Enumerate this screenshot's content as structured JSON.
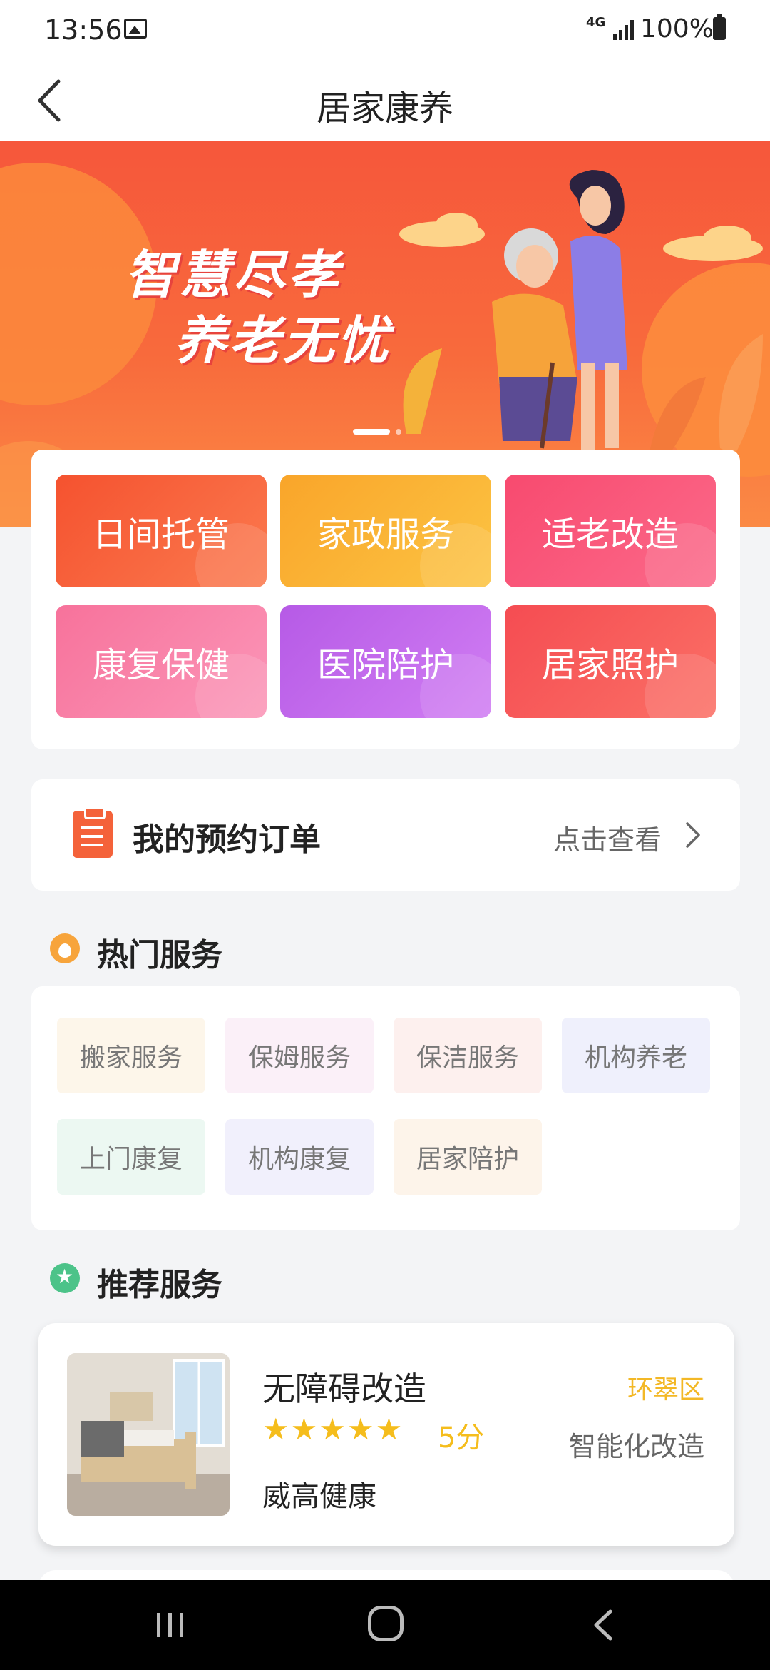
{
  "status_bar": {
    "time": "13:56",
    "network": "4G",
    "battery": "100%"
  },
  "nav": {
    "title": "居家康养"
  },
  "banner": {
    "line1": "智慧尽孝",
    "line2": "养老无忧",
    "slide_index": 1,
    "slide_count": 2
  },
  "categories": [
    {
      "label": "日间托管",
      "color": "#f5522f"
    },
    {
      "label": "家政服务",
      "color": "#f9a52a"
    },
    {
      "label": "适老改造",
      "color": "#f84a6f"
    },
    {
      "label": "康复保健",
      "color": "#f7729b"
    },
    {
      "label": "医院陪护",
      "color": "#b65ae6"
    },
    {
      "label": "居家照护",
      "color": "#f54c52"
    }
  ],
  "orders": {
    "title": "我的预约订单",
    "link": "点击查看"
  },
  "hot_services": {
    "title": "热门服务",
    "tags": [
      "搬家服务",
      "保姆服务",
      "保洁服务",
      "机构养老",
      "上门康复",
      "机构康复",
      "居家陪护"
    ]
  },
  "recommended": {
    "title": "推荐服务",
    "items": [
      {
        "name": "无障碍改造",
        "stars": "★★★★★",
        "rating": 5,
        "score": "5分",
        "provider": "威高健康",
        "district": "环翠区",
        "type": "智能化改造"
      }
    ]
  },
  "colors": {
    "accent": "#f4623a",
    "star": "#f5bd1c",
    "district": "#f3b826"
  }
}
